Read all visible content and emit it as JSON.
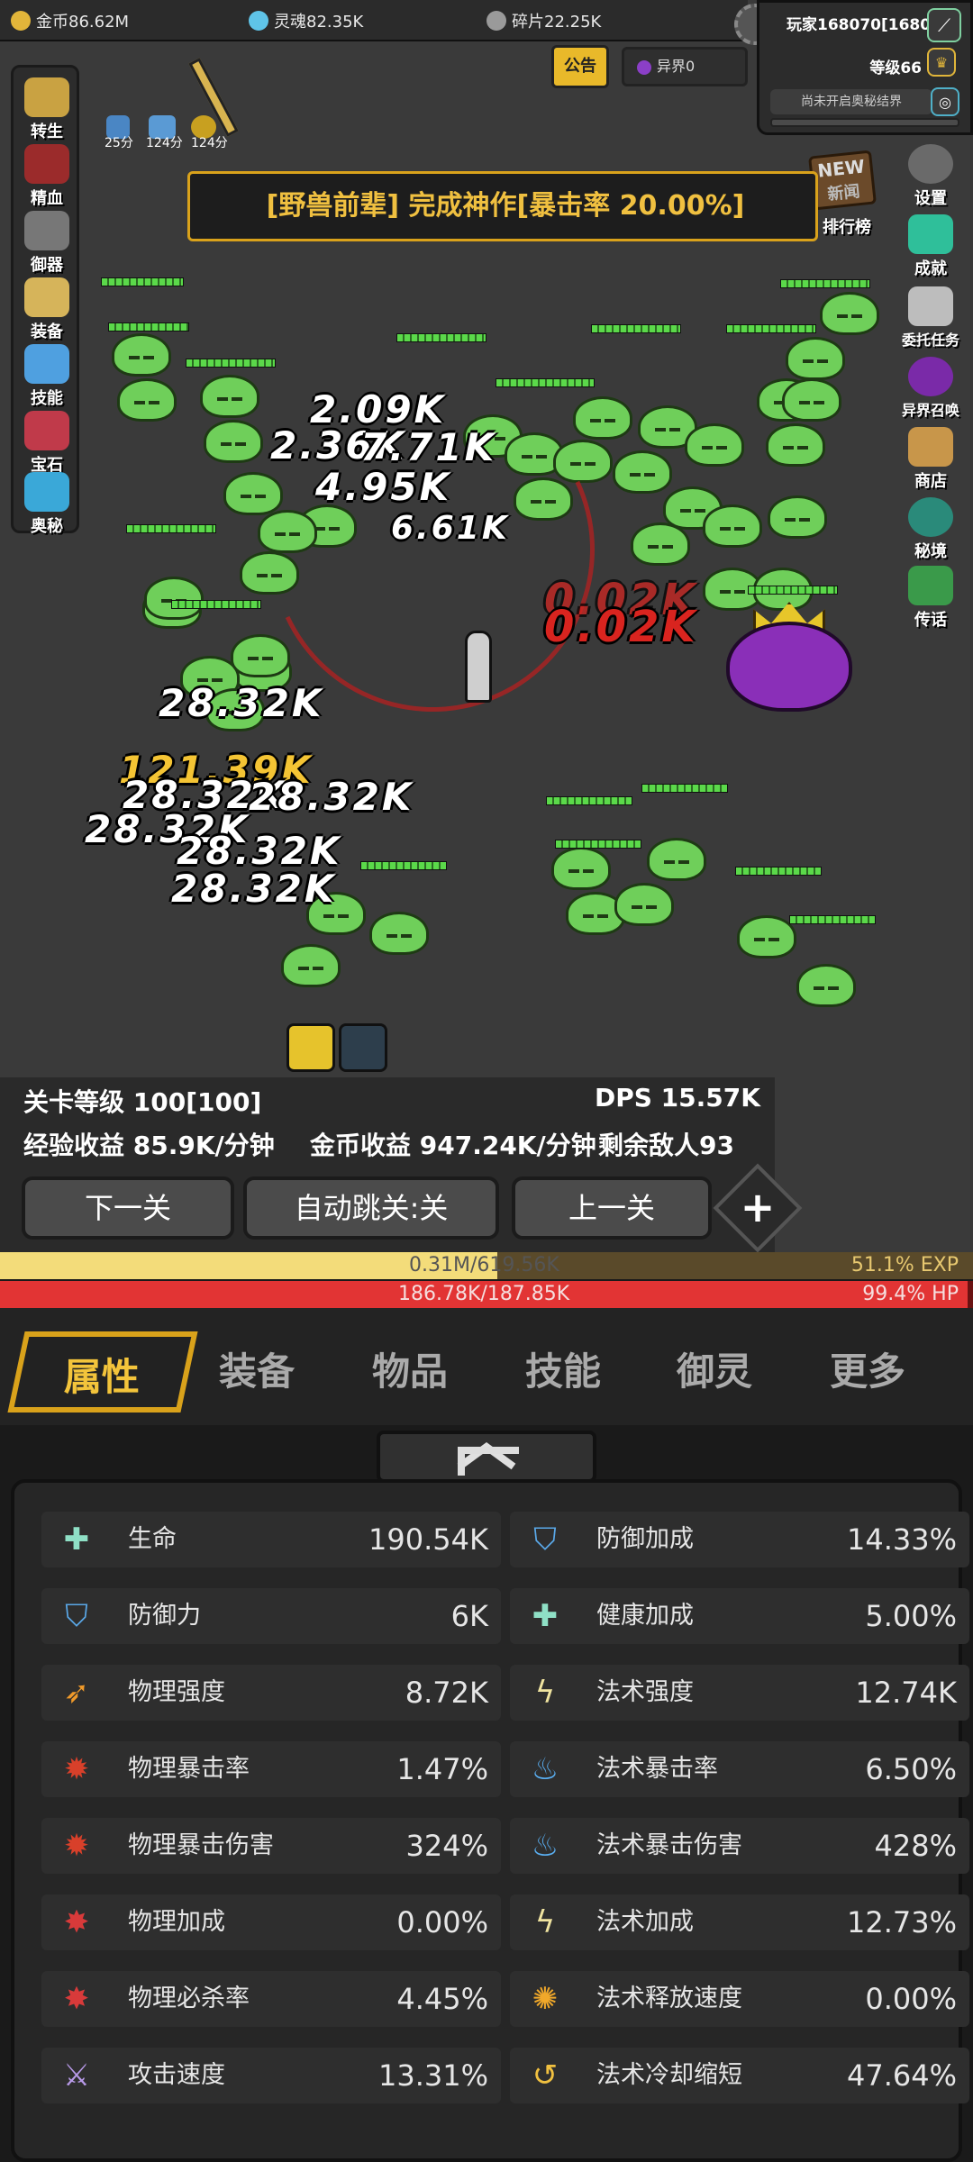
{
  "resources": {
    "gold": "金币86.62M",
    "soul": "灵魂82.35K",
    "shard": "碎片22.25K"
  },
  "player": {
    "name": "玩家168070[168070]",
    "level": "等级66",
    "realm": "尚未开启奥秘结界"
  },
  "notice_label": "公告",
  "otherworld_label": "异界0",
  "buffs": [
    "25分",
    "124分",
    "124分"
  ],
  "left_menu": [
    "转生",
    "精血",
    "御器",
    "装备",
    "技能",
    "宝石",
    "奥秘"
  ],
  "right_menu": [
    "设置",
    "成就",
    "委托任务",
    "异界召唤",
    "商店",
    "秘境",
    "传话"
  ],
  "news": {
    "badge": "NEW",
    "label": "新闻"
  },
  "rank_label": "排行榜",
  "banner": "[野兽前辈] 完成神作[暴击率 20.00%]",
  "damage_numbers": [
    "2.09K",
    "2.36K",
    "7.71K",
    "4.95K",
    "6.61K",
    "0.02K",
    "0.02K",
    "28.32K",
    "121.39K",
    "28.32K",
    "28.32K",
    "28.32K",
    "28.32K",
    "28.32K"
  ],
  "stats": {
    "stage_level": "关卡等级 100[100]",
    "dps": "DPS 15.57K",
    "exp_rate": "经验收益 85.9K/分钟",
    "gold_rate": "金币收益 947.24K/分钟",
    "enemies_left": "剩余敌人93"
  },
  "buttons": {
    "next": "下一关",
    "auto_skip": "自动跳关:关",
    "prev": "上一关",
    "plus": "+"
  },
  "exp_bar": {
    "value": "0.31M/619.56K",
    "percent": "51.1% EXP",
    "fill": 0.511
  },
  "hp_bar": {
    "value": "186.78K/187.85K",
    "percent": "99.4%  HP",
    "fill": 0.994
  },
  "tabs": [
    "属性",
    "装备",
    "物品",
    "技能",
    "御灵",
    "更多"
  ],
  "attributes_left": [
    {
      "name": "生命",
      "value": "190.54K",
      "icon": "plus-icon"
    },
    {
      "name": "防御力",
      "value": "6K",
      "icon": "shield-icon"
    },
    {
      "name": "物理强度",
      "value": "8.72K",
      "icon": "feather-icon"
    },
    {
      "name": "物理暴击率",
      "value": "1.47%",
      "icon": "claw-icon"
    },
    {
      "name": "物理暴击伤害",
      "value": "324%",
      "icon": "claw-icon"
    },
    {
      "name": "物理加成",
      "value": "0.00%",
      "icon": "burst-icon"
    },
    {
      "name": "物理必杀率",
      "value": "4.45%",
      "icon": "burst-icon"
    },
    {
      "name": "攻击速度",
      "value": "13.31%",
      "icon": "sword-icon"
    }
  ],
  "attributes_right": [
    {
      "name": "防御加成",
      "value": "14.33%",
      "icon": "shield-icon"
    },
    {
      "name": "健康加成",
      "value": "5.00%",
      "icon": "plus-icon"
    },
    {
      "name": "法术强度",
      "value": "12.74K",
      "icon": "lightning-icon"
    },
    {
      "name": "法术暴击率",
      "value": "6.50%",
      "icon": "flame-icon"
    },
    {
      "name": "法术暴击伤害",
      "value": "428%",
      "icon": "flame-icon"
    },
    {
      "name": "法术加成",
      "value": "12.73%",
      "icon": "lightning-icon"
    },
    {
      "name": "法术释放速度",
      "value": "0.00%",
      "icon": "fire-badge-icon"
    },
    {
      "name": "法术冷却缩短",
      "value": "47.64%",
      "icon": "swirl-icon"
    }
  ]
}
